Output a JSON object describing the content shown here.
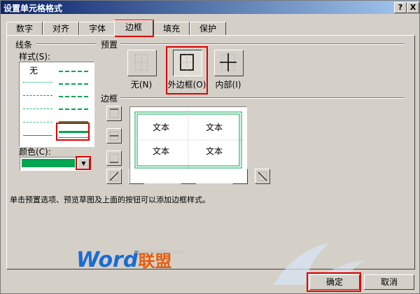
{
  "window": {
    "title": "设置单元格格式",
    "help_label": "?",
    "close_label": "X"
  },
  "tabs": [
    {
      "label": "数字",
      "active": false
    },
    {
      "label": "对齐",
      "active": false
    },
    {
      "label": "字体",
      "active": false
    },
    {
      "label": "边框",
      "active": true
    },
    {
      "label": "填充",
      "active": false
    },
    {
      "label": "保护",
      "active": false
    }
  ],
  "line_group": {
    "title": "线条",
    "style_label": "样式(S):",
    "none_label": "无",
    "color_label": "颜色(C):",
    "color_value": "#00a651"
  },
  "presets": {
    "title": "预置",
    "none_label": "无(N)",
    "outline_label": "外边框(O)",
    "inside_label": "内部(I)"
  },
  "border": {
    "title": "边框",
    "preview_cells": [
      "文本",
      "文本",
      "文本",
      "文本"
    ]
  },
  "note": "单击预置选项、预览草图及上面的按钮可以添加边框样式。",
  "buttons": {
    "ok_label": "确定",
    "cancel_label": "取消"
  },
  "watermark": {
    "logo_text": "Word",
    "logo_cn": "联盟",
    "url": "www.wordlm.com"
  },
  "colors": {
    "highlight": "#e00000",
    "border_green": "#00a651",
    "title_bar": "#0a246a"
  }
}
